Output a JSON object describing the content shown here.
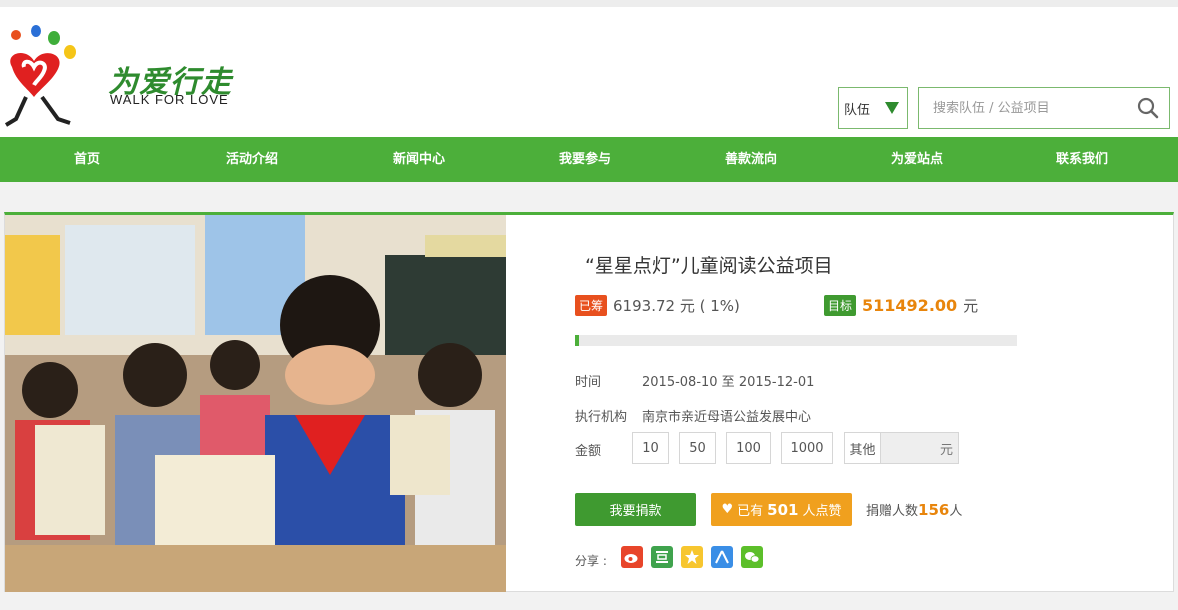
{
  "brand": {
    "name_cn": "为爱行走",
    "name_en": "WALK FOR LOVE"
  },
  "search": {
    "category": "队伍",
    "placeholder": "搜索队伍 / 公益项目"
  },
  "nav": {
    "items": [
      "首页",
      "活动介绍",
      "新闻中心",
      "我要参与",
      "善款流向",
      "为爱站点",
      "联系我们"
    ]
  },
  "project": {
    "title": "“星星点灯”儿童阅读公益项目",
    "raised_badge": "已筹",
    "raised_amount": "6193.72 元 ( 1%)",
    "raised_percent": 1,
    "goal_badge": "目标",
    "goal_amount": "511492.00",
    "goal_unit": "元",
    "time_label": "时间",
    "time_value": "2015-08-10 至 2015-12-01",
    "org_label": "执行机构",
    "org_value": "南京市亲近母语公益发展中心",
    "amount_label": "金额",
    "amount_options": [
      "10",
      "50",
      "100",
      "1000"
    ],
    "other_label": "其他",
    "other_unit": "元",
    "donate_label": "我要捐款",
    "like_prefix": "已有",
    "like_count": "501",
    "like_suffix": "人点赞",
    "donors_prefix": "捐赠人数",
    "donors_count": "156",
    "donors_suffix": "人",
    "share_label": "分享 :"
  },
  "colors": {
    "brand_green": "#4caf3a",
    "accent_orange": "#f0a01e",
    "raised_red": "#e8501e"
  },
  "share_icons": [
    "weibo-icon",
    "douban-icon",
    "qzone-icon",
    "renren-icon",
    "wechat-icon"
  ]
}
